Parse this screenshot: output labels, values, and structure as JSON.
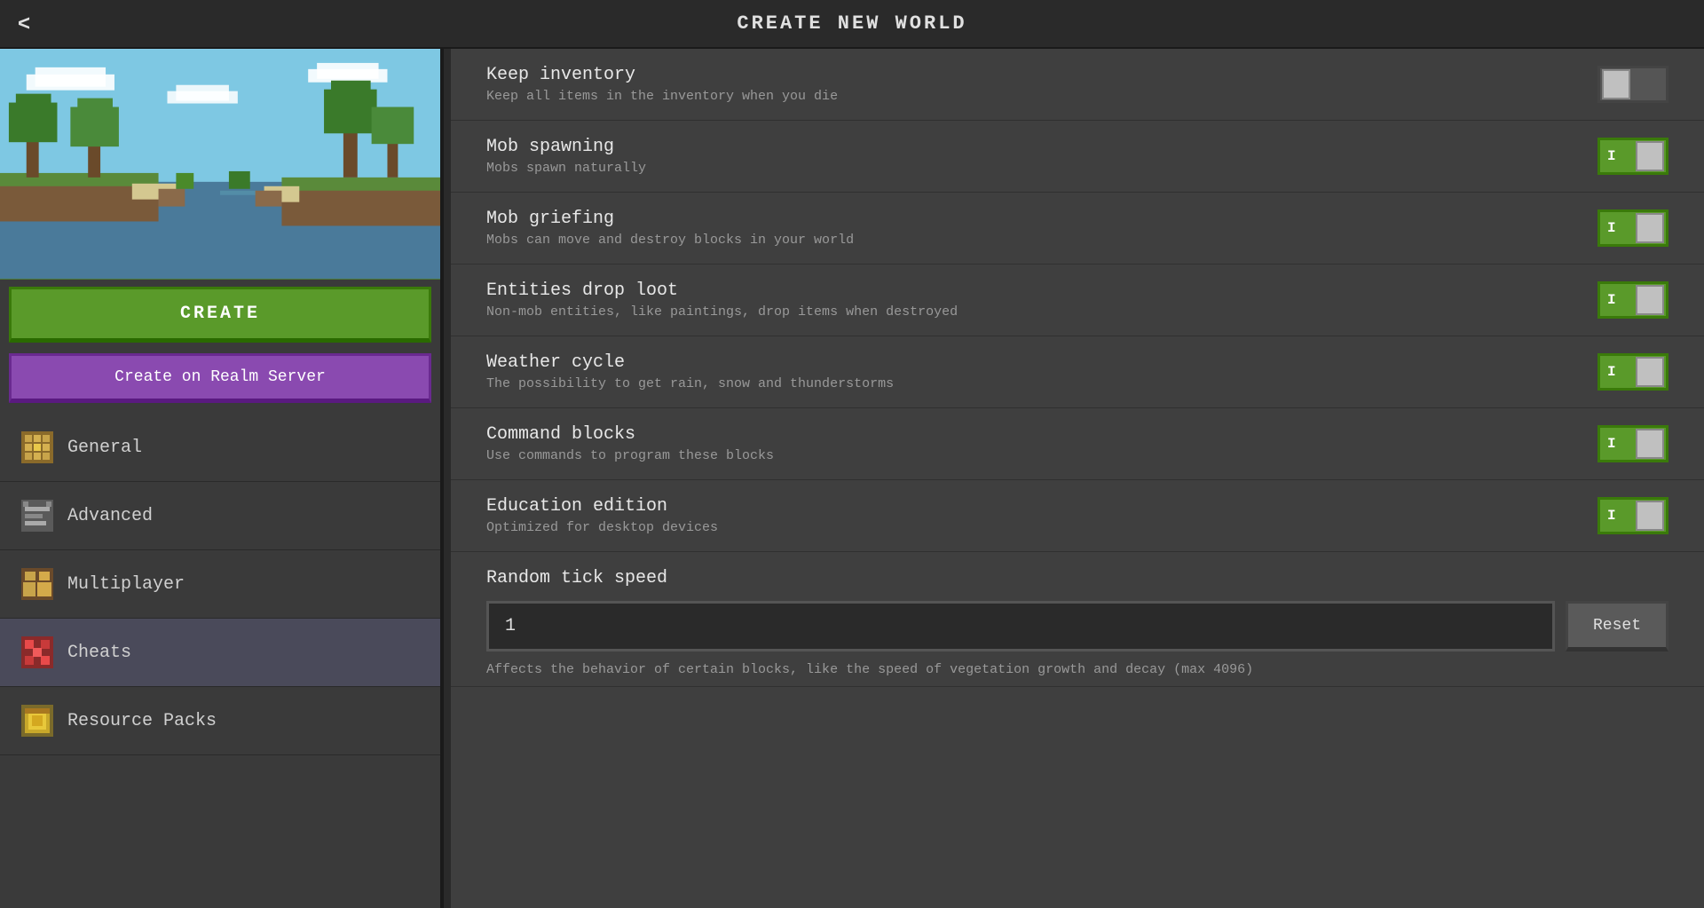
{
  "header": {
    "title": "CREATE NEW WORLD",
    "back_label": "<"
  },
  "sidebar": {
    "create_label": "CREATE",
    "realm_label": "Create on Realm Server",
    "nav_items": [
      {
        "id": "general",
        "label": "General",
        "icon": "general-icon"
      },
      {
        "id": "advanced",
        "label": "Advanced",
        "icon": "advanced-icon"
      },
      {
        "id": "multiplayer",
        "label": "Multiplayer",
        "icon": "multiplayer-icon"
      },
      {
        "id": "cheats",
        "label": "Cheats",
        "icon": "cheats-icon"
      },
      {
        "id": "resource-packs",
        "label": "Resource Packs",
        "icon": "resource-packs-icon"
      }
    ]
  },
  "settings": [
    {
      "id": "keep-inventory",
      "title": "Keep inventory",
      "desc": "Keep all items in the inventory when you die",
      "toggle": "off"
    },
    {
      "id": "mob-spawning",
      "title": "Mob spawning",
      "desc": "Mobs spawn naturally",
      "toggle": "on"
    },
    {
      "id": "mob-griefing",
      "title": "Mob griefing",
      "desc": "Mobs can move and destroy blocks in your world",
      "toggle": "on"
    },
    {
      "id": "entities-drop-loot",
      "title": "Entities drop loot",
      "desc": "Non-mob entities, like paintings, drop items when destroyed",
      "toggle": "on"
    },
    {
      "id": "weather-cycle",
      "title": "Weather cycle",
      "desc": "The possibility to get rain, snow and thunderstorms",
      "toggle": "on"
    },
    {
      "id": "command-blocks",
      "title": "Command blocks",
      "desc": "Use commands to program these blocks",
      "toggle": "on"
    },
    {
      "id": "education-edition",
      "title": "Education edition",
      "desc": "Optimized for desktop devices",
      "toggle": "on"
    }
  ],
  "random_tick": {
    "title": "Random tick speed",
    "value": "1",
    "reset_label": "Reset",
    "desc": "Affects the behavior of certain blocks, like the speed of vegetation growth and decay (max 4096)"
  }
}
